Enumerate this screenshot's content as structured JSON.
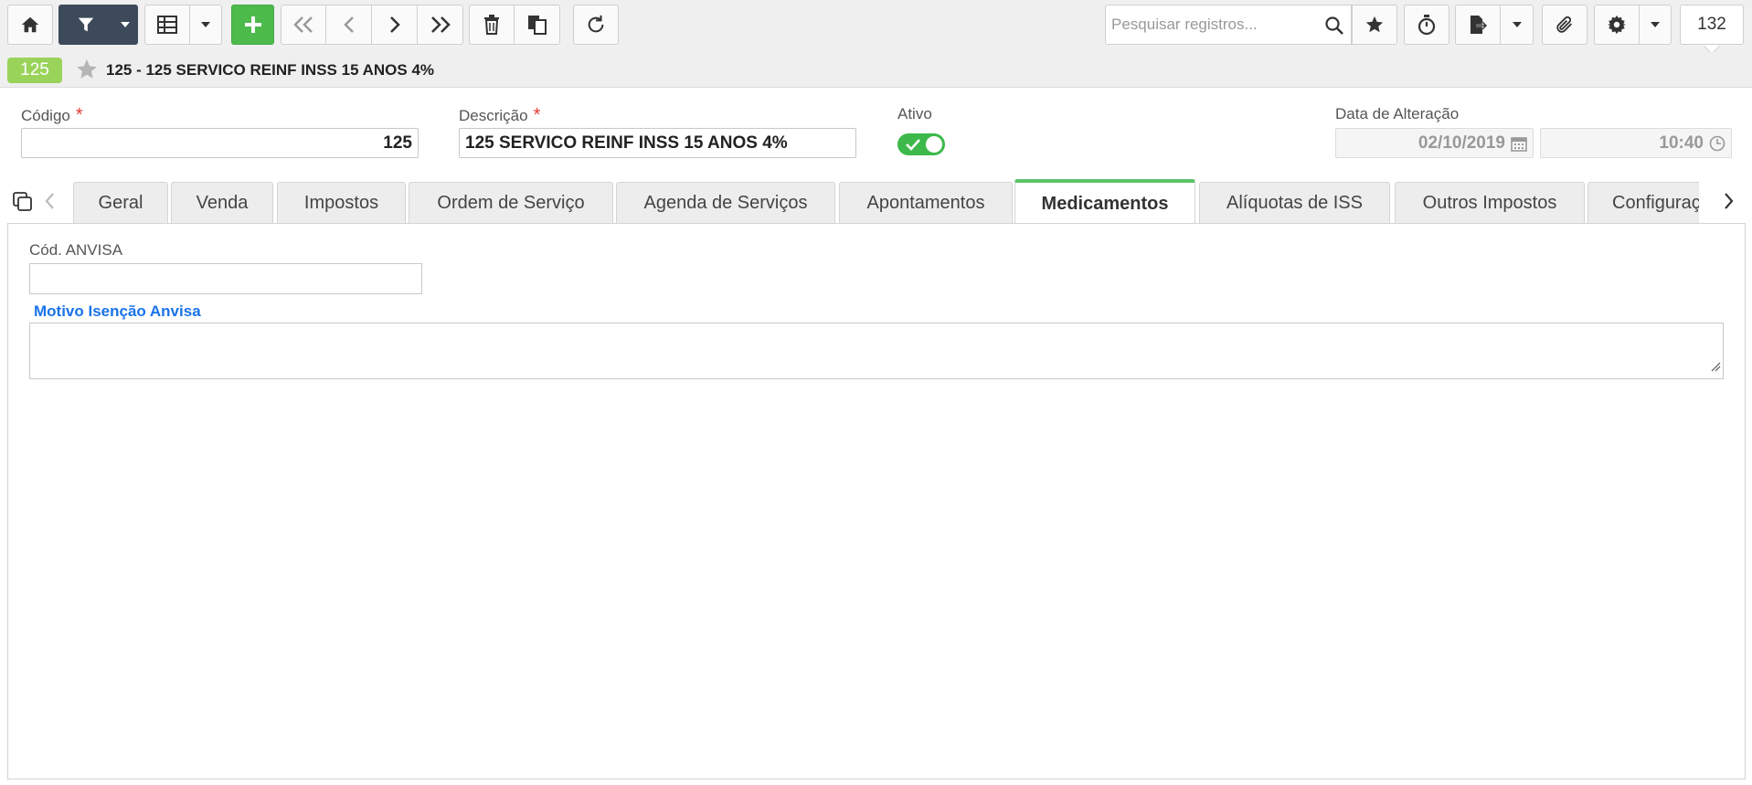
{
  "toolbar": {
    "search_placeholder": "Pesquisar registros...",
    "record_count": "132",
    "icons": {
      "home": "home-icon",
      "filter": "filter-icon",
      "grid": "grid-icon",
      "add": "plus-icon",
      "first": "double-chevron-left-icon",
      "prev": "chevron-left-icon",
      "next": "chevron-right-icon",
      "last": "double-chevron-right-icon",
      "delete": "trash-icon",
      "copy": "copy-icon",
      "refresh": "refresh-icon",
      "favorite": "star-icon",
      "timer": "stopwatch-icon",
      "export": "export-icon",
      "attach": "paperclip-icon",
      "settings": "gear-icon"
    }
  },
  "record": {
    "badge": "125",
    "title": "125 - 125 SERVICO REINF INSS 15 ANOS 4%"
  },
  "form": {
    "codigo": {
      "label": "Código",
      "required_mark": "*",
      "value": "125"
    },
    "descricao": {
      "label": "Descrição",
      "required_mark": "*",
      "value": "125 SERVICO REINF INSS 15 ANOS 4%"
    },
    "ativo": {
      "label": "Ativo",
      "checked": true
    },
    "data_alteracao": {
      "label": "Data de Alteração",
      "date": "02/10/2019",
      "time": "10:40"
    }
  },
  "tabs": [
    {
      "label": "Geral",
      "active": false
    },
    {
      "label": "Venda",
      "active": false
    },
    {
      "label": "Impostos",
      "active": false
    },
    {
      "label": "Ordem de Serviço",
      "active": false
    },
    {
      "label": "Agenda de Serviços",
      "active": false
    },
    {
      "label": "Apontamentos",
      "active": false
    },
    {
      "label": "Medicamentos",
      "active": true
    },
    {
      "label": "Alíquotas de ISS",
      "active": false
    },
    {
      "label": "Outros Impostos",
      "active": false
    },
    {
      "label": "Configurações",
      "active": false
    }
  ],
  "medicamentos": {
    "cod_anvisa_label": "Cód. ANVISA",
    "cod_anvisa_value": "",
    "motivo_label": "Motivo Isenção Anvisa",
    "motivo_value": ""
  },
  "colors": {
    "accent_green": "#4cbb4c",
    "active_tab_border": "#5bc466",
    "badge_green": "#9ad35a",
    "dark_button": "#3c4a5a",
    "link_blue": "#1a73e8",
    "required_red": "#e53935"
  }
}
